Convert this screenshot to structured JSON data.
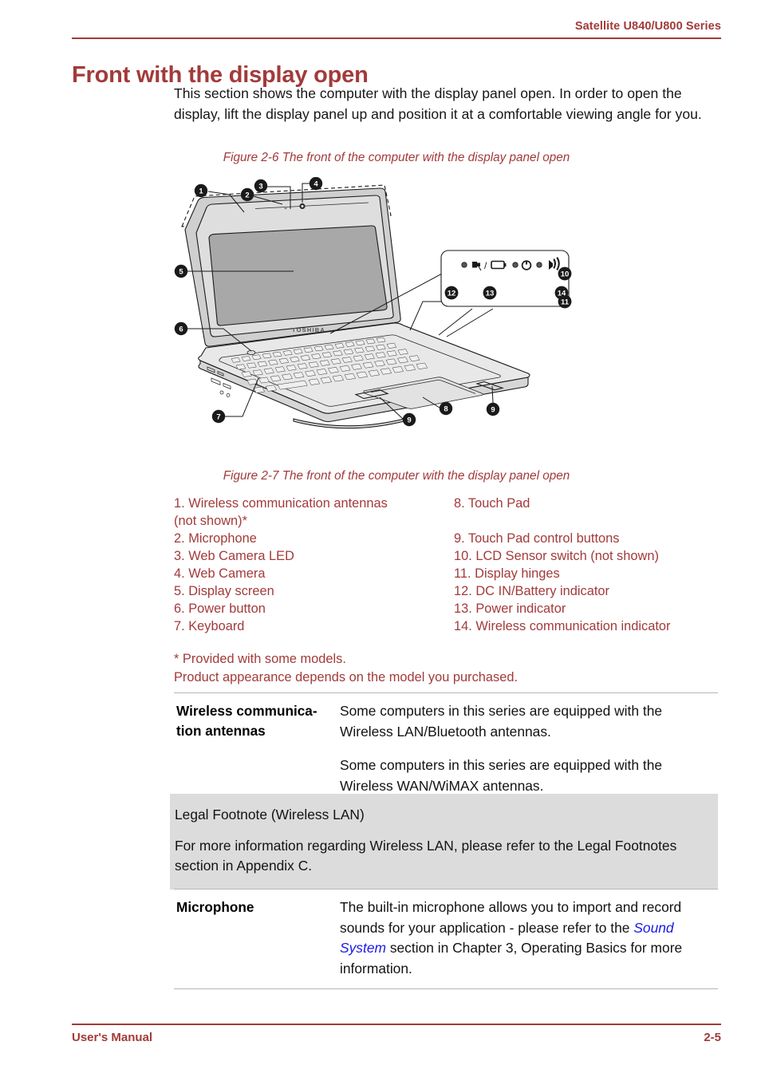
{
  "header": {
    "series": "Satellite U840/U800 Series"
  },
  "title": "Front with the display open",
  "intro": "This section shows the computer with the display panel open. In order to open the display, lift the display panel up and position it at a comfortable viewing angle for you.",
  "figures": {
    "caption_top": "Figure 2-6 The front of the computer with the display panel open",
    "caption_bottom": "Figure 2-7 The front of the computer with the display panel open",
    "brand_text": "TOSHIBA",
    "callouts": [
      "1",
      "2",
      "3",
      "4",
      "5",
      "6",
      "7",
      "8",
      "9",
      "9",
      "10",
      "11",
      "12",
      "13",
      "14"
    ]
  },
  "legend": {
    "left": [
      "1. Wireless communication antennas\n(not shown)*",
      "2. Microphone",
      "3. Web Camera LED",
      "4. Web Camera",
      "5. Display screen",
      "6. Power button",
      "7. Keyboard"
    ],
    "right": [
      "8. Touch Pad",
      "9. Touch Pad control buttons",
      "10. LCD Sensor switch (not shown)",
      "11. Display hinges",
      "12. DC IN/Battery indicator",
      "13. Power indicator",
      "14. Wireless communication indicator"
    ],
    "notes": [
      "* Provided with some models.",
      "Product appearance depends on the model you purchased."
    ]
  },
  "definitions": [
    {
      "term": "Wireless communica-\ntion antennas",
      "paragraphs": [
        "Some computers in this series are equipped with the Wireless LAN/Bluetooth antennas.",
        "Some computers in this series are equipped with the Wireless WAN/WiMAX antennas."
      ]
    }
  ],
  "callout_box": {
    "heading": "Legal Footnote (Wireless LAN)",
    "body": "For more information regarding Wireless LAN, please refer to the Legal Footnotes section in Appendix C."
  },
  "microphone_row": {
    "term": "Microphone",
    "text_before": "The built-in microphone allows you to import and record sounds for your application - please refer to the ",
    "link": "Sound System",
    "text_after": " section in Chapter 3, Operating Basics for more information."
  },
  "footer": {
    "left": "User's Manual",
    "right": "2-5"
  },
  "colors": {
    "brand_red": "#A33A3A",
    "link_blue": "#1a1ae6",
    "callout_bg": "#dcdcdc",
    "rule_gray": "#b6b6b6"
  }
}
